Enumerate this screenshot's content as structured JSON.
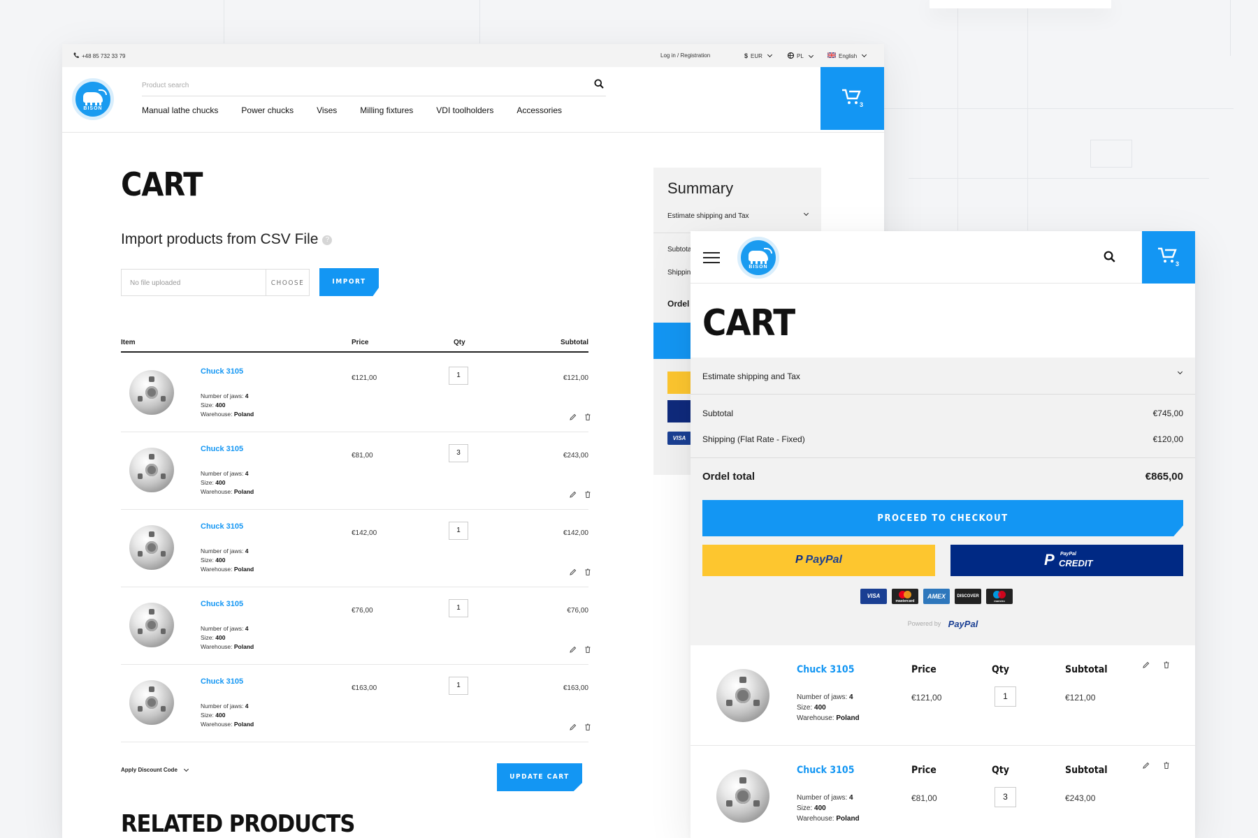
{
  "colors": {
    "accent": "#1396f3",
    "paypal_yellow": "#fdc62f",
    "paypal_navy": "#002984"
  },
  "desktop": {
    "topbar": {
      "phone": "+48 85 732 33 79",
      "login": "Log in / Registration",
      "currency": "EUR",
      "currency_symbol": "$",
      "country": "PL",
      "language": "English"
    },
    "logo_text": "BISON",
    "search_placeholder": "Product search",
    "nav": [
      "Manual lathe chucks",
      "Power chucks",
      "Vises",
      "Milling fixtures",
      "VDI toolholders",
      "Accessories"
    ],
    "cart_count": "3",
    "page_title": "CART",
    "import_title": "Import products from CSV File",
    "help_glyph": "?",
    "file_placeholder": "No file uploaded",
    "choose_label": "CHOOSE",
    "import_label": "IMPORT",
    "columns": {
      "item": "Item",
      "price": "Price",
      "qty": "Qty",
      "subtotal": "Subtotal"
    },
    "spec_labels": {
      "jaws": "Number of jaws:",
      "size": "Size:",
      "warehouse": "Warehouse:"
    },
    "items": [
      {
        "name": "Chuck 3105",
        "jaws": "4",
        "size": "400",
        "warehouse": "Poland",
        "price": "€121,00",
        "qty": "1",
        "subtotal": "€121,00"
      },
      {
        "name": "Chuck 3105",
        "jaws": "4",
        "size": "400",
        "warehouse": "Poland",
        "price": "€81,00",
        "qty": "3",
        "subtotal": "€243,00"
      },
      {
        "name": "Chuck 3105",
        "jaws": "4",
        "size": "400",
        "warehouse": "Poland",
        "price": "€142,00",
        "qty": "1",
        "subtotal": "€142,00"
      },
      {
        "name": "Chuck 3105",
        "jaws": "4",
        "size": "400",
        "warehouse": "Poland",
        "price": "€76,00",
        "qty": "1",
        "subtotal": "€76,00"
      },
      {
        "name": "Chuck 3105",
        "jaws": "4",
        "size": "400",
        "warehouse": "Poland",
        "price": "€163,00",
        "qty": "1",
        "subtotal": "€163,00"
      }
    ],
    "discount_label": "Apply Discount Code",
    "update_label": "UPDATE CART",
    "related_title": "RELATED PRODUCTS",
    "summary": {
      "title": "Summary",
      "estimate": "Estimate shipping and Tax",
      "subtotal_partial": "Subtota",
      "shipping_partial": "Shippin",
      "total_partial": "Ordel t",
      "visa": "VISA"
    }
  },
  "mobile": {
    "logo_text": "BISON",
    "cart_count": "3",
    "page_title": "CART",
    "estimate": "Estimate shipping and Tax",
    "subtotal_label": "Subtotal",
    "subtotal_value": "€745,00",
    "shipping_label": "Shipping (Flat Rate - Fixed)",
    "shipping_value": "€120,00",
    "total_label": "Ordel total",
    "total_value": "€865,00",
    "checkout_label": "PROCEED TO CHECKOUT",
    "paypal_label": "PayPal",
    "credit_small": "PayPal",
    "credit_label": "CREDIT",
    "cards": [
      "VISA",
      "mastercard",
      "AMEX",
      "DISCOVER",
      "maestro"
    ],
    "powered_by": "Powered by",
    "powered_brand": "PayPal",
    "col_price": "Price",
    "col_qty": "Qty",
    "col_subtotal": "Subtotal",
    "spec_labels": {
      "jaws": "Number of jaws:",
      "size": "Size:",
      "warehouse": "Warehouse:"
    },
    "items": [
      {
        "name": "Chuck 3105",
        "jaws": "4",
        "size": "400",
        "warehouse": "Poland",
        "price": "€121,00",
        "qty": "1",
        "subtotal": "€121,00"
      },
      {
        "name": "Chuck 3105",
        "jaws": "4",
        "size": "400",
        "warehouse": "Poland",
        "price": "€81,00",
        "qty": "3",
        "subtotal": "€243,00"
      }
    ]
  }
}
